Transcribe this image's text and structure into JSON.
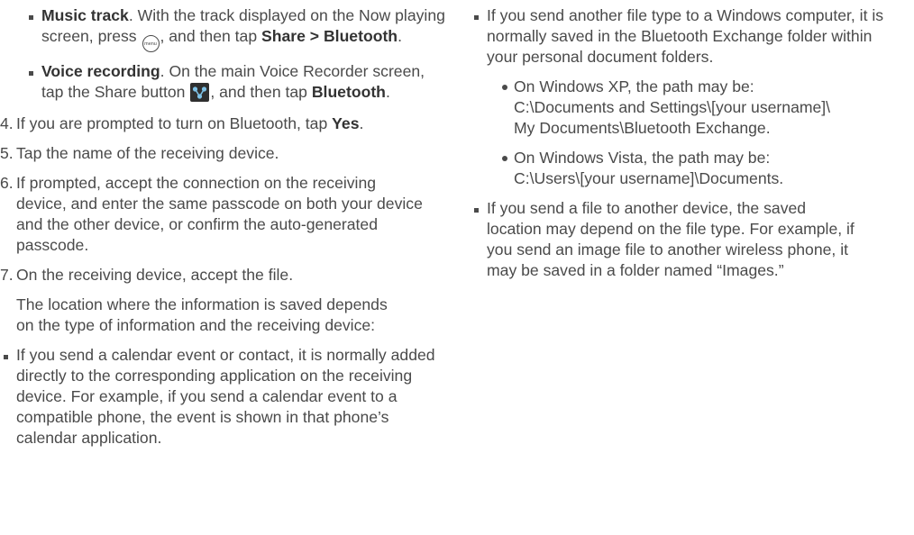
{
  "left": {
    "music": {
      "bold": "Music track",
      "t1": ". With the track displayed on the Now playing screen, press ",
      "menu_key_text": "menu",
      "t2": ", and then tap ",
      "share": "Share",
      "sep": " > ",
      "bluetooth": "Bluetooth",
      "t3": "."
    },
    "voice": {
      "bold": "Voice recording",
      "t1": ". On the main Voice Recorder screen, tap the Share button ",
      "t2": ", and then tap ",
      "bluetooth": "Bluetooth",
      "t3": "."
    },
    "step4": {
      "n": "4.",
      "t1": "If you are prompted to turn on Bluetooth, tap ",
      "yes": "Yes",
      "t2": "."
    },
    "step5": {
      "n": "5.",
      "text": "Tap the name of the receiving device."
    },
    "step6": {
      "n": "6.",
      "text": "If prompted, accept the connection on the receiving device, and enter the same passcode on both your device and the other device, or confirm the auto-generated passcode."
    },
    "step7": {
      "n": "7.",
      "text": "On the receiving device, accept the file."
    },
    "location_para": "The location where the information is saved depends on the type of information and the receiving device:",
    "calendar_bullet": "If you send a calendar event or contact, it is normally added directly to the corresponding application on the receiving device. For example, if you send a calendar event to a compatible phone, the event is shown in that phone’s calendar application."
  },
  "right": {
    "windows_bullet": "If you send another file type to a Windows computer, it is normally saved in the Bluetooth Exchange folder within your personal document folders.",
    "xp": {
      "t1": "On Windows XP, the path may be:",
      "t2": "C:\\Documents and Settings\\[your username]\\",
      "t3": "My Documents\\Bluetooth Exchange."
    },
    "vista": {
      "t1": "On Windows Vista, the path may be:",
      "t2": "C:\\Users\\[your username]\\Documents."
    },
    "device_bullet": "If you send a file to another device, the saved location may depend on the file type. For example, if you send an image file to another wireless phone, it may be saved in a folder named “Images.”"
  },
  "icons": {
    "menu_key": "menu-key-icon",
    "share_button": "share-button-icon"
  }
}
